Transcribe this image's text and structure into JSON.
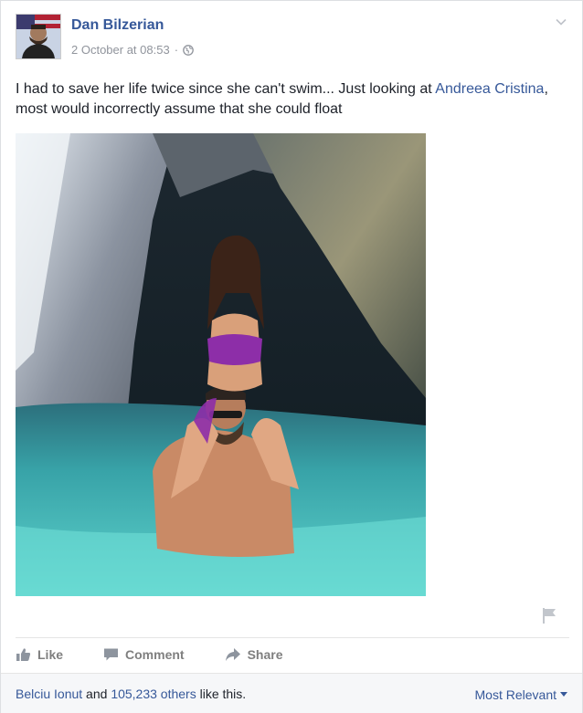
{
  "post": {
    "author": "Dan Bilzerian",
    "timestamp": "2 October at 08:53",
    "separator": "·",
    "privacy_icon": "globe-icon",
    "text_before": "I had to save her life twice since she can't swim... Just looking at ",
    "tagged_name": "Andreea Cristina",
    "text_after": ", most would incorrectly assume that she could float"
  },
  "actions": {
    "like_label": "Like",
    "comment_label": "Comment",
    "share_label": "Share"
  },
  "footer": {
    "likes_name": "Belciu Ionut",
    "likes_and": " and ",
    "likes_others": "105,233 others",
    "likes_suffix": " like this.",
    "sort_label": "Most Relevant"
  },
  "colors": {
    "link": "#365899",
    "meta": "#90949c",
    "water": "#4fc0bd",
    "rock": "#6f7780"
  }
}
